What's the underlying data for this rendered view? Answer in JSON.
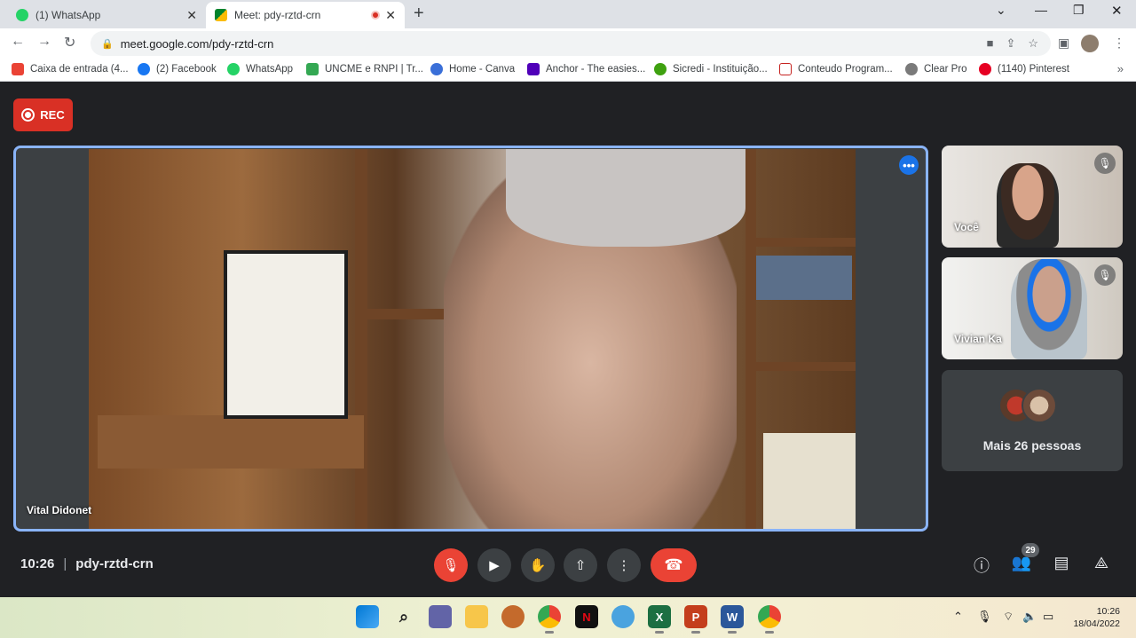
{
  "browser": {
    "tabs": [
      {
        "title": "(1) WhatsApp",
        "favicon": "whatsapp-icon",
        "active": false
      },
      {
        "title": "Meet: pdy-rztd-crn",
        "favicon": "google-meet-icon",
        "active": true
      }
    ],
    "url": "meet.google.com/pdy-rztd-crn",
    "bookmarks": [
      {
        "label": "Caixa de entrada (4...",
        "icon": "gmail-icon",
        "color": "#ea4335"
      },
      {
        "label": "(2) Facebook",
        "icon": "facebook-icon",
        "color": "#1877f2"
      },
      {
        "label": "WhatsApp",
        "icon": "whatsapp-icon",
        "color": "#25d366"
      },
      {
        "label": "UNCME e RNPI | Tr...",
        "icon": "doc-icon",
        "color": "#34a853"
      },
      {
        "label": "Home - Canva",
        "icon": "canva-icon",
        "color": "#3a6fd8"
      },
      {
        "label": "Anchor - The easies...",
        "icon": "anchor-icon",
        "color": "#5000b9"
      },
      {
        "label": "Sicredi - Instituição...",
        "icon": "sicredi-icon",
        "color": "#3fa110"
      },
      {
        "label": "Conteudo Program...",
        "icon": "page-icon",
        "color": "#c5221f"
      },
      {
        "label": "Clear Pro",
        "icon": "clear-icon",
        "color": "#7a7a7a"
      },
      {
        "label": "(1140) Pinterest",
        "icon": "pinterest-icon",
        "color": "#e60023"
      }
    ]
  },
  "meet": {
    "rec_label": "REC",
    "main_speaker": "Vital Didonet",
    "participants": [
      {
        "name": "Você",
        "muted": true
      },
      {
        "name": "Vivian Ka",
        "muted": true
      }
    ],
    "more_label": "Mais 26 pessoas",
    "time": "10:26",
    "meeting_code": "pdy-rztd-crn",
    "participant_count": "29"
  },
  "taskbar": {
    "time": "10:26",
    "date": "18/04/2022"
  },
  "colors": {
    "accent": "#8ab4f8",
    "danger": "#ea4335",
    "meet_bg": "#202124"
  }
}
